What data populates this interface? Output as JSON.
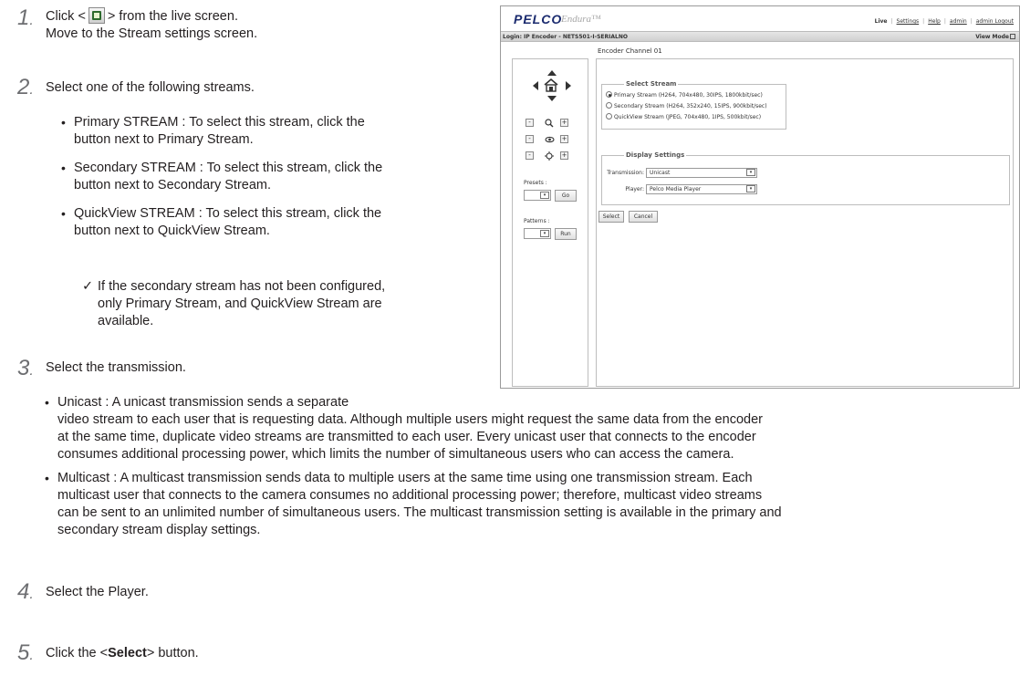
{
  "steps": [
    {
      "num": "1",
      "line1_a": "Click <",
      "line1_b": "> from the live screen.",
      "line2": "Move to the Stream settings screen."
    },
    {
      "num": "2",
      "text": "Select one of the following streams."
    },
    {
      "num": "3",
      "text": "Select the transmission."
    },
    {
      "num": "4",
      "text": "Select the Player."
    },
    {
      "num": "5",
      "pre": "Click the <",
      "bold": "Select",
      "post": "> button."
    }
  ],
  "stream_bullets": [
    {
      "l1": "Primary STREAM : To select this stream, click the",
      "l2": "button next to Primary Stream."
    },
    {
      "l1": "Secondary STREAM : To select this stream, click the",
      "l2": "button next to Secondary Stream."
    },
    {
      "l1": "QuickView STREAM : To select this stream, click the",
      "l2": "button next to QuickView Stream."
    }
  ],
  "note": {
    "mark": "✓",
    "l1": "If the secondary stream has not been configured,",
    "l2": "only Primary Stream, and QuickView Stream are",
    "l3": "available."
  },
  "transmission_bullets": [
    {
      "l1": "Unicast : A unicast transmission sends a separate",
      "l2": "video stream to each user that is requesting data. Although multiple users might request the same data from the encoder",
      "l3": "at the same time, duplicate video streams are transmitted to each user. Every unicast user that connects to the encoder",
      "l4": "consumes additional processing power, which limits the number of simultaneous users who can access the camera."
    },
    {
      "l1": " Multicast : A multicast transmission sends data to multiple users at the same time using one transmission stream. Each",
      "l2": "multicast user that connects to the camera consumes no additional processing power; therefore, multicast video streams",
      "l3": "can be sent to an unlimited number of simultaneous users. The multicast transmission setting is available in the primary and",
      "l4": "secondary stream display settings."
    }
  ],
  "screenshot": {
    "logo": "PELCO",
    "brand": "Endura™",
    "links": {
      "live": "Live",
      "settings": "Settings",
      "help": "Help",
      "admin": "admin",
      "logout": "admin Logout",
      "sep": "|"
    },
    "login": "Login: IP Encoder - NETS501-I-SERIALNO",
    "view_mode": "View Mode",
    "channel": "Encoder Channel 01",
    "zoom_minus": "-",
    "zoom_plus": "+",
    "presets_label": "Presets :",
    "go": "Go",
    "patterns_label": "Patterns :",
    "run": "Run",
    "select_stream": {
      "legend": "Select Stream",
      "options": [
        "Primary Stream (H264, 704x480, 30IPS, 1800kbit/sec)",
        "Secondary Stream (H264, 352x240, 15IPS, 900kbit/sec)",
        "QuickView Stream (JPEG, 704x480, 1IPS, 500kbit/sec)"
      ],
      "selected": 0
    },
    "display_settings": {
      "legend": "Display Settings",
      "transmission_label": "Transmission:",
      "transmission_value": "Unicast",
      "player_label": "Player:",
      "player_value": "Pelco Media Player"
    },
    "select_button": "Select",
    "cancel_button": "Cancel"
  },
  "icons": {
    "bullet": "•",
    "caret": "▾",
    "search": "🔍",
    "eye": "👁",
    "gear": "✲"
  }
}
